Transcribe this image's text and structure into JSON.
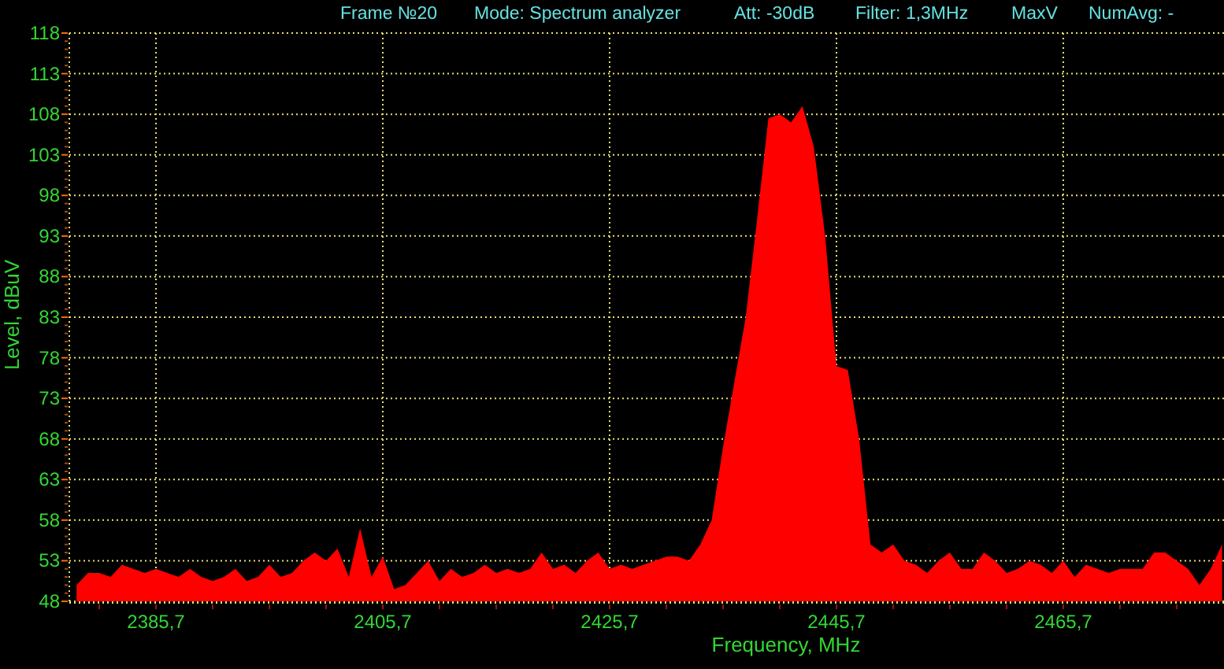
{
  "header": [
    "Frame №20",
    "Mode: Spectrum analyzer",
    "Att: -30dB",
    "Filter: 1,3MHz",
    "MaxV",
    "NumAvg: -"
  ],
  "chart_data": {
    "type": "area",
    "grid": true,
    "xlabel": "Frequency, MHz",
    "ylabel": "Level, dBuV",
    "xlim": [
      2378.06,
      2479.87
    ],
    "ylim": [
      48,
      118
    ],
    "xticks": [
      {
        "value": 2385.7,
        "label": "2385,7"
      },
      {
        "value": 2405.7,
        "label": "2405,7"
      },
      {
        "value": 2425.7,
        "label": "2425,7"
      },
      {
        "value": 2445.7,
        "label": "2445,7"
      },
      {
        "value": 2465.7,
        "label": "2465,7"
      }
    ],
    "yticks": [
      48,
      53,
      58,
      63,
      68,
      73,
      78,
      83,
      88,
      93,
      98,
      103,
      108,
      113,
      118
    ],
    "x": [
      2378.7,
      2379.7,
      2380.7,
      2381.7,
      2382.7,
      2383.7,
      2384.7,
      2385.7,
      2386.7,
      2387.7,
      2388.7,
      2389.7,
      2390.7,
      2391.7,
      2392.7,
      2393.7,
      2394.7,
      2395.7,
      2396.7,
      2397.7,
      2398.7,
      2399.7,
      2400.7,
      2401.7,
      2402.7,
      2403.7,
      2404.7,
      2405.7,
      2406.7,
      2407.7,
      2408.7,
      2409.7,
      2410.7,
      2411.7,
      2412.7,
      2413.7,
      2414.7,
      2415.7,
      2416.7,
      2417.7,
      2418.7,
      2419.7,
      2420.7,
      2421.7,
      2422.7,
      2423.7,
      2424.7,
      2425.7,
      2426.7,
      2427.7,
      2428.7,
      2429.7,
      2430.7,
      2431.7,
      2432.7,
      2433.7,
      2434.7,
      2435.7,
      2436.7,
      2437.7,
      2438.7,
      2439.7,
      2440.7,
      2441.7,
      2442.7,
      2443.7,
      2444.7,
      2445.7,
      2446.7,
      2447.7,
      2448.7,
      2449.7,
      2450.7,
      2451.7,
      2452.7,
      2453.7,
      2454.7,
      2455.7,
      2456.7,
      2457.7,
      2458.7,
      2459.7,
      2460.7,
      2461.7,
      2462.7,
      2463.7,
      2464.7,
      2465.7,
      2466.7,
      2467.7,
      2468.7,
      2469.7,
      2470.7,
      2471.7,
      2472.7,
      2473.7,
      2474.7,
      2475.7,
      2476.7,
      2477.7,
      2478.7,
      2479.7
    ],
    "series": [
      {
        "color": "#ff0000",
        "values": [
          50,
          51.5,
          51.5,
          51,
          52.5,
          52,
          51.5,
          52,
          51.5,
          51,
          52,
          51,
          50.5,
          51,
          52,
          50.5,
          51,
          52.5,
          51,
          51.5,
          53,
          54,
          53,
          54.5,
          51,
          57,
          51,
          53.5,
          49.5,
          50,
          51.5,
          53,
          50.5,
          52,
          51,
          51.5,
          52.5,
          51.5,
          52,
          51.5,
          52,
          54,
          52,
          52.5,
          51.5,
          53,
          54,
          52,
          52.5,
          52,
          52.5,
          53,
          53.5,
          53.5,
          53,
          55,
          58,
          67,
          75,
          83,
          95,
          107.5,
          108,
          107,
          109,
          104,
          93,
          77,
          76.5,
          68,
          55,
          54,
          55,
          53,
          52.5,
          51.5,
          53,
          54,
          52,
          52,
          54,
          53,
          51.5,
          52,
          53,
          52.5,
          51.5,
          53,
          51,
          52.5,
          52,
          51.5,
          52,
          52,
          52,
          54,
          54,
          53,
          52,
          50,
          52,
          55
        ]
      }
    ]
  }
}
